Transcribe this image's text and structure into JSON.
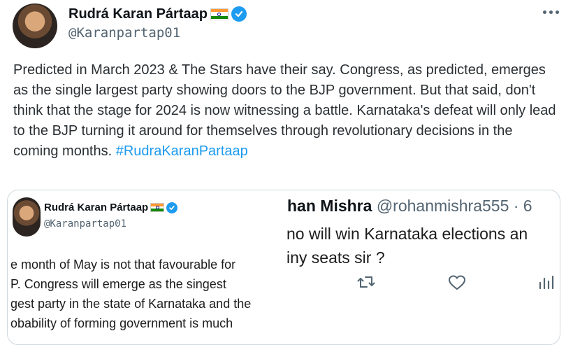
{
  "tweet": {
    "author_name": "Rudrá Karan Pártaap",
    "handle": "@Karanpartap01",
    "text_main": "Predicted in March 2023 & The Stars have their say. Congress, as predicted, emerges as the single largest party showing doors to the BJP government. But that said, don't think that the stage for 2024 is now witnessing a battle. Karnataka's defeat will only lead to the BJP turning it around for themselves through revolutionary decisions in the coming months. ",
    "hashtag": "#RudraKaranPartaap",
    "icons": [
      "verified-badge-icon",
      "india-flag-icon",
      "more-options-icon"
    ]
  },
  "quoted_left": {
    "author_name": "Rudrá Karan Pártaap",
    "handle": "@Karanpartap01",
    "lines": [
      "e month of May is not that favourable for",
      "P. Congress will emerge as the singest",
      "gest party in the state of Karnataka and the",
      "obability of forming government is much"
    ]
  },
  "quoted_right": {
    "name": "han Mishra",
    "handle": "@rohanmishra555 · 6",
    "lines": [
      "no will win Karnataka elections an",
      "iny seats sir ?"
    ],
    "icons": [
      "retweet-icon",
      "like-icon",
      "views-icon"
    ]
  },
  "colors": {
    "link": "#1d9bf0",
    "secondary_text": "#536471",
    "border": "#cfd9de"
  }
}
